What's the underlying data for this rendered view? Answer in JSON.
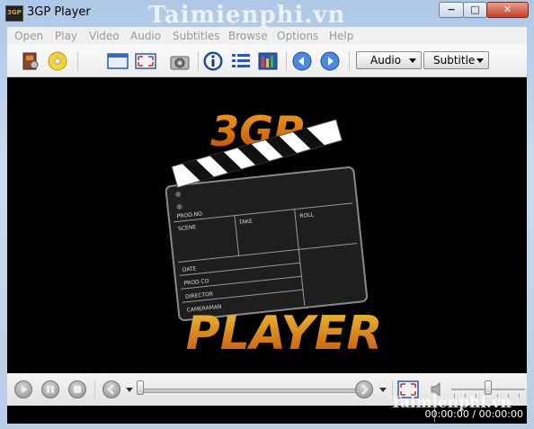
{
  "window": {
    "title": "3GP Player",
    "watermark": "Taimienphi.vn",
    "app_icon_text": "3GP"
  },
  "caption_buttons": {
    "minimize": "−",
    "maximize": "□",
    "close": "✕"
  },
  "menu": [
    "Open",
    "Play",
    "Video",
    "Audio",
    "Subtitles",
    "Browse",
    "Options",
    "Help"
  ],
  "toolbar": {
    "icons": [
      "open-file-icon",
      "open-disc-icon",
      "video-window-icon",
      "fullscreen-icon",
      "snapshot-camera-icon",
      "info-icon",
      "playlist-icon",
      "settings-tools-icon",
      "previous-globe-icon",
      "next-globe-icon"
    ],
    "audio_label": "Audio",
    "subtitle_label": "Subtitle"
  },
  "video": {
    "logo_top": "3GP",
    "logo_bottom": "PLAYER",
    "clapper": {
      "prod_no": "PROD.NO.",
      "scene": "SCENE",
      "take": "TAKE",
      "roll": "ROLL",
      "date": "DATE",
      "prod_co": "PROD.CO",
      "director": "DIRECTOR",
      "cameraman": "CAMERAMAN"
    }
  },
  "controls": {
    "seek_position": 0.0,
    "volume_level": 0.72
  },
  "status": {
    "time": "00:00:00 / 00:00:00"
  },
  "colors": {
    "title_bar": "#c9dbef",
    "logo_top": "#e07810",
    "logo_bottom": "#d9a020",
    "background": "#000000"
  }
}
